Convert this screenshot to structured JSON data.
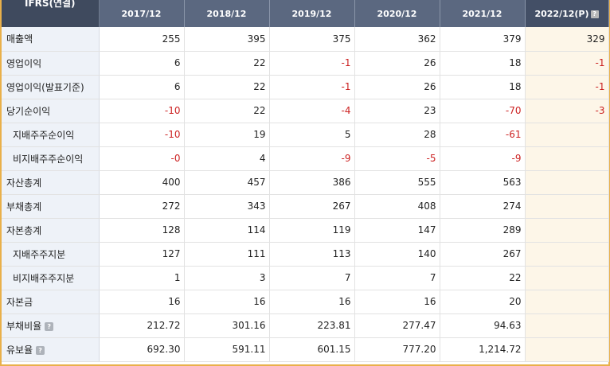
{
  "header": {
    "corner_label": "IFRS(연결)",
    "years": [
      "2017/12",
      "2018/12",
      "2019/12",
      "2020/12",
      "2021/12"
    ],
    "projection_label": "2022/12(P)",
    "help_glyph": "?"
  },
  "rows": [
    {
      "label": "매출액",
      "sub": false,
      "help": false,
      "values": [
        "255",
        "395",
        "375",
        "362",
        "379"
      ],
      "proj": "329"
    },
    {
      "label": "영업이익",
      "sub": false,
      "help": false,
      "values": [
        "6",
        "22",
        "-1",
        "26",
        "18"
      ],
      "proj": "-1"
    },
    {
      "label": "영업이익(발표기준)",
      "sub": false,
      "help": false,
      "values": [
        "6",
        "22",
        "-1",
        "26",
        "18"
      ],
      "proj": "-1"
    },
    {
      "label": "당기순이익",
      "sub": false,
      "help": false,
      "values": [
        "-10",
        "22",
        "-4",
        "23",
        "-70"
      ],
      "proj": "-3"
    },
    {
      "label": "지배주주순이익",
      "sub": true,
      "help": false,
      "values": [
        "-10",
        "19",
        "5",
        "28",
        "-61"
      ],
      "proj": ""
    },
    {
      "label": "비지배주주순이익",
      "sub": true,
      "help": false,
      "values": [
        "-0",
        "4",
        "-9",
        "-5",
        "-9"
      ],
      "proj": ""
    },
    {
      "label": "자산총계",
      "sub": false,
      "help": false,
      "values": [
        "400",
        "457",
        "386",
        "555",
        "563"
      ],
      "proj": ""
    },
    {
      "label": "부채총계",
      "sub": false,
      "help": false,
      "values": [
        "272",
        "343",
        "267",
        "408",
        "274"
      ],
      "proj": ""
    },
    {
      "label": "자본총계",
      "sub": false,
      "help": false,
      "values": [
        "128",
        "114",
        "119",
        "147",
        "289"
      ],
      "proj": ""
    },
    {
      "label": "지배주주지분",
      "sub": true,
      "help": false,
      "values": [
        "127",
        "111",
        "113",
        "140",
        "267"
      ],
      "proj": ""
    },
    {
      "label": "비지배주주지분",
      "sub": true,
      "help": false,
      "values": [
        "1",
        "3",
        "7",
        "7",
        "22"
      ],
      "proj": ""
    },
    {
      "label": "자본금",
      "sub": false,
      "help": false,
      "values": [
        "16",
        "16",
        "16",
        "16",
        "20"
      ],
      "proj": ""
    },
    {
      "label": "부채비율",
      "sub": false,
      "help": true,
      "values": [
        "212.72",
        "301.16",
        "223.81",
        "277.47",
        "94.63"
      ],
      "proj": ""
    },
    {
      "label": "유보율",
      "sub": false,
      "help": true,
      "values": [
        "692.30",
        "591.11",
        "601.15",
        "777.20",
        "1,214.72"
      ],
      "proj": ""
    }
  ],
  "colors": {
    "header_bg": "#5b6880",
    "label_bg": "#eef2f8",
    "projection_bg": "#fdf6e8",
    "negative": "#cc2222",
    "frame": "#e9b04a"
  }
}
